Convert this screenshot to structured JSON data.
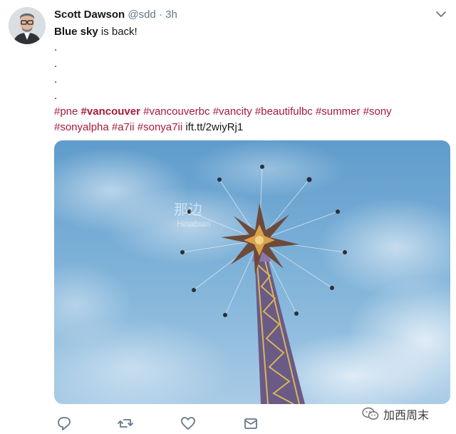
{
  "tweet": {
    "name": "Scott Dawson",
    "handle": "@sdd",
    "separator": "·",
    "time": "3h",
    "line1_bold": "Blue sky",
    "line1_rest": " is back!",
    "dots": [
      ".",
      ".",
      ".",
      "."
    ],
    "hashtags_line1": [
      "#pne",
      "#vancouver",
      "#vancouverbc",
      "#vancity",
      "#beautifulbc",
      "#summer",
      "#sony"
    ],
    "hashtags_line2": [
      "#sonyalpha",
      "#a7ii",
      "#sonya7ii"
    ],
    "link": "ift.tt/2wiyRj1"
  },
  "photo": {
    "watermark_cn": "那边",
    "watermark_en": "Hinabian"
  },
  "actions": {
    "icons": [
      "reply-icon",
      "retweet-icon",
      "like-icon",
      "message-icon"
    ]
  },
  "wechat_watermark": "加西周末",
  "colors": {
    "hashtag": "#a6193a",
    "muted": "#657786",
    "icon": "#657786"
  }
}
